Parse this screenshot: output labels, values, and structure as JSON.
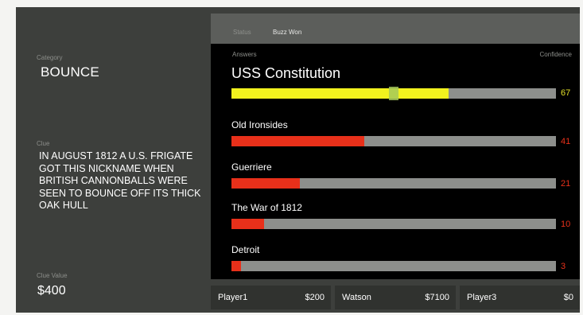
{
  "category": {
    "label": "Category",
    "value": "BOUNCE"
  },
  "clue": {
    "label": "Clue",
    "text": "IN AUGUST 1812 A U.S. FRIGATE GOT THIS NICKNAME WHEN BRITISH CANNONBALLS WERE SEEN TO BOUNCE OFF ITS THICK OAK HULL"
  },
  "clue_value": {
    "label": "Clue Value",
    "value": "$400"
  },
  "status_bar": {
    "status": "Status",
    "buzz": "Buzz Won"
  },
  "answers_panel": {
    "answers_label": "Answers",
    "confidence_label": "Confidence",
    "threshold_percent": 50,
    "answers": [
      {
        "text": "USS Constitution",
        "confidence": 67,
        "confidence_label": "67"
      },
      {
        "text": "Old Ironsides",
        "confidence": 41,
        "confidence_label": "41"
      },
      {
        "text": "Guerriere",
        "confidence": 21,
        "confidence_label": "21"
      },
      {
        "text": "The War of 1812",
        "confidence": 10,
        "confidence_label": "10"
      },
      {
        "text": "Detroit",
        "confidence": 3,
        "confidence_label": "3"
      }
    ]
  },
  "players": [
    {
      "name": "Player1",
      "score": "$200"
    },
    {
      "name": "Watson",
      "score": "$7100"
    },
    {
      "name": "Player3",
      "score": "$0"
    }
  ],
  "colors": {
    "top_bar": "#f2f21e",
    "other_bar": "#e8301a",
    "track": "#8d8f8c",
    "threshold_marker": "#a6c95a"
  }
}
